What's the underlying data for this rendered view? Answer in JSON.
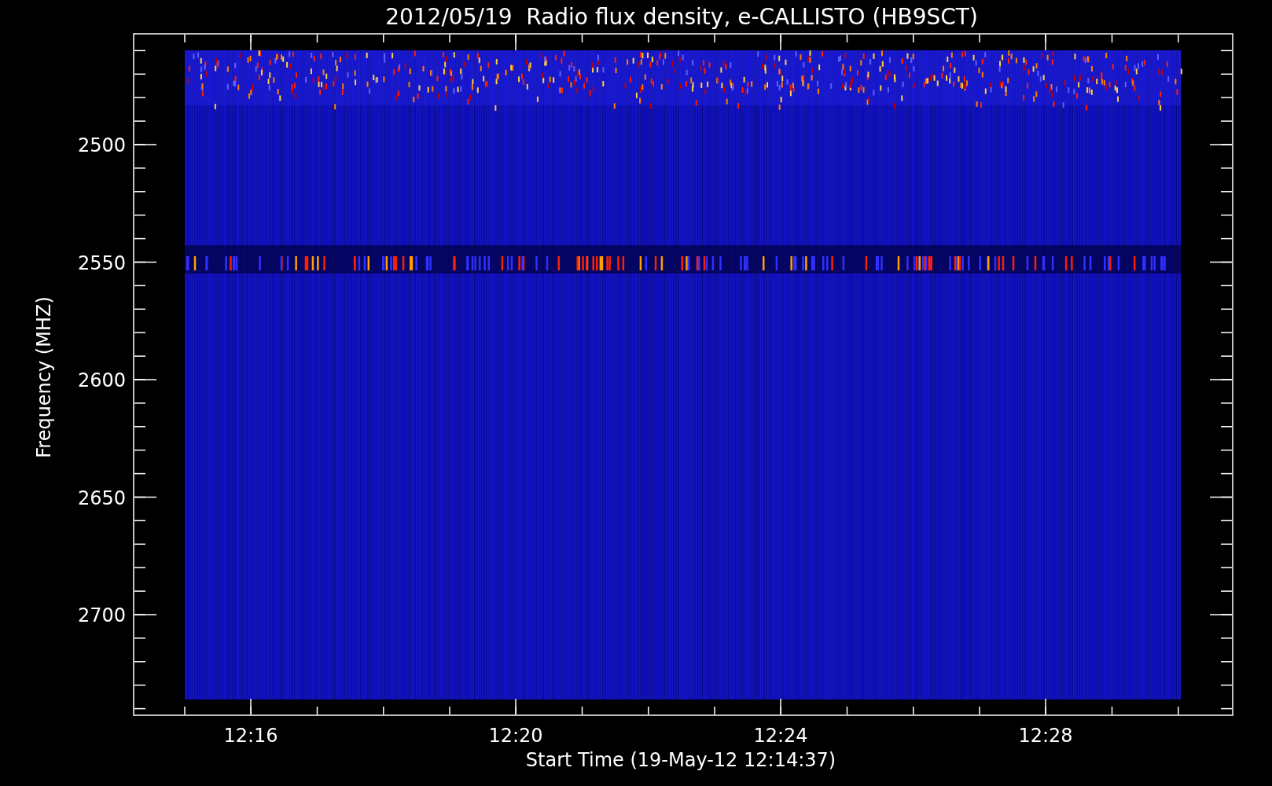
{
  "title": "2012/05/19  Radio flux density, e-CALLISTO (HB9SCT)",
  "y_axis": {
    "label": "Frequency (MHZ)",
    "ticks": [
      "2500",
      "2550",
      "2600",
      "2650",
      "2700"
    ]
  },
  "x_axis": {
    "label": "Start Time (19-May-12 12:14:37)",
    "ticks": [
      "12:16",
      "12:20",
      "12:24",
      "12:28"
    ]
  }
}
